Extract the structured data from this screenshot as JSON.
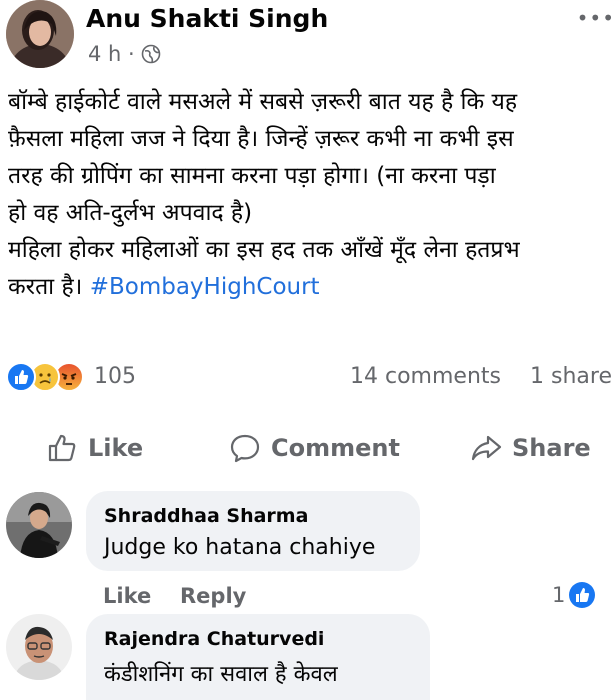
{
  "post": {
    "author": "Anu Shakti Singh",
    "time": "4 h ·",
    "more_icon": "•••",
    "text_lines": [
      "बॉम्बे हाईकोर्ट वाले मसअले में सबसे ज़रूरी बात यह है कि यह",
      "फ़ैसला महिला जज ने दिया है। जिन्हें ज़रूर कभी ना कभी इस",
      "तरह की ग्रोपिंग का सामना करना पड़ा होगा। (ना करना पड़ा",
      "हो वह अति-दुर्लभ अपवाद है)",
      "महिला होकर महिलाओं का इस हद तक आँखें मूँद लेना हतप्रभ"
    ],
    "last_line_text": "करता है। ",
    "hashtag": "#BombayHighCourt"
  },
  "stats": {
    "reactions_count": "105",
    "comments": "14 comments",
    "shares": "1 share",
    "reaction_icons": [
      "like-reaction-icon",
      "sad-reaction-icon",
      "angry-reaction-icon"
    ]
  },
  "actions": {
    "like": "Like",
    "comment": "Comment",
    "share": "Share"
  },
  "comments": [
    {
      "name": "Shraddhaa Sharma",
      "text": "Judge ko hatana chahiye",
      "like_label": "Like",
      "reply_label": "Reply",
      "reaction_count": "1"
    },
    {
      "name": "Rajendra Chaturvedi",
      "text": "कंडीशनिंग का सवाल है केवल"
    }
  ],
  "colors": {
    "link_blue": "#216fdb",
    "meta_gray": "#65676b",
    "bubble_bg": "#f0f2f5",
    "like_blue": "#1877f2"
  }
}
